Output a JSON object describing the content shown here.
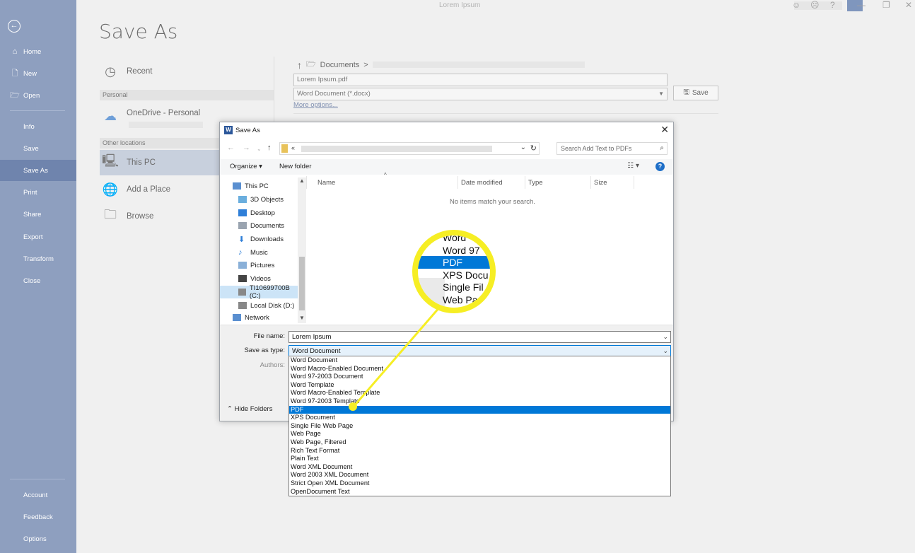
{
  "window": {
    "doc_title": "Lorem Ipsum",
    "help_label": "?",
    "controls": [
      "—",
      "❐",
      "✕"
    ]
  },
  "sidebar": {
    "back_label": "←",
    "top_items": [
      {
        "label": "Home",
        "icon": "⌂"
      },
      {
        "label": "New",
        "icon": "🗋"
      },
      {
        "label": "Open",
        "icon": "🗁"
      }
    ],
    "mid_items": [
      "Info",
      "Save",
      "Save As",
      "Print",
      "Share",
      "Export",
      "Transform",
      "Close"
    ],
    "active": "Save As",
    "bottom_items": [
      "Account",
      "Feedback",
      "Options"
    ]
  },
  "backstage": {
    "title": "Save As",
    "recent_label": "Recent",
    "personal_header": "Personal",
    "onedrive_label": "OneDrive - Personal",
    "other_header": "Other locations",
    "this_pc_label": "This PC",
    "add_place_label": "Add a Place",
    "browse_label": "Browse",
    "path_up": "↑",
    "path_folder": "Documents",
    "path_sep": ">",
    "file_name": "Lorem Ipsum.pdf",
    "file_type": "Word Document (*.docx)",
    "save_label": "Save",
    "more_options": "More options..."
  },
  "dialog": {
    "title": "Save As",
    "address_prefix": "«",
    "search_placeholder": "Search Add Text to PDFs",
    "organize_label": "Organize ▾",
    "new_folder_label": "New folder",
    "nav_items": [
      "This PC",
      "3D Objects",
      "Desktop",
      "Documents",
      "Downloads",
      "Music",
      "Pictures",
      "Videos",
      "TI10699700B (C:)",
      "Local Disk (D:)",
      "Network"
    ],
    "columns": [
      "Name",
      "Date modified",
      "Type",
      "Size"
    ],
    "empty_message": "No items match your search.",
    "file_name_label": "File name:",
    "file_name_value": "Lorem Ipsum",
    "save_type_label": "Save as type:",
    "save_type_value": "Word Document",
    "authors_label": "Authors:",
    "hide_folders_label": "Hide Folders"
  },
  "type_options": [
    "Word Document",
    "Word Macro-Enabled Document",
    "Word 97-2003 Document",
    "Word Template",
    "Word Macro-Enabled Template",
    "Word 97-2003 Template",
    "PDF",
    "XPS Document",
    "Single File Web Page",
    "Web Page",
    "Web Page, Filtered",
    "Rich Text Format",
    "Plain Text",
    "Word XML Document",
    "Word 2003 XML Document",
    "Strict Open XML Document",
    "OpenDocument Text"
  ],
  "selected_type": "PDF",
  "magnifier": [
    "Word",
    "Word 97",
    "PDF",
    "XPS Docu",
    "Single Fil",
    "Web Pa"
  ],
  "colors": {
    "highlight": "#f6ee24",
    "selection": "#0078d7",
    "sidebar": "#2b579a"
  }
}
